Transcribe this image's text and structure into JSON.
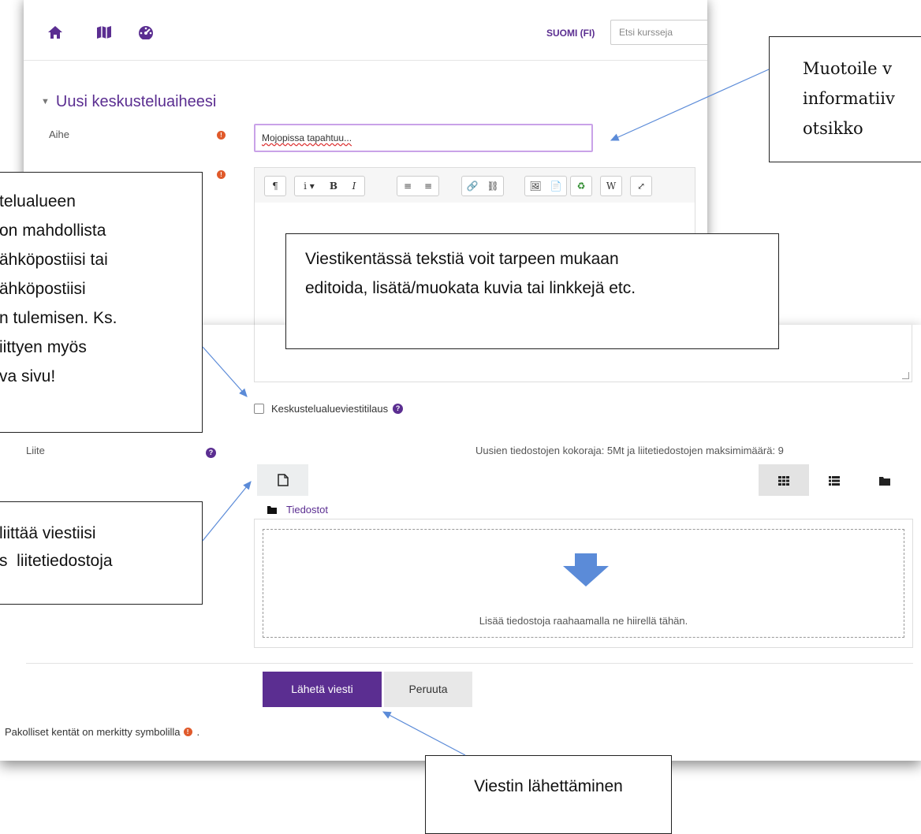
{
  "header": {
    "language": "SUOMI (FI)",
    "search_placeholder": "Etsi kursseja",
    "icons": [
      "home-icon",
      "map-icon",
      "dashboard-icon"
    ]
  },
  "form": {
    "section_title": "Uusi keskusteluaiheesi",
    "subject_label": "Aihe",
    "subject_value": "Mojopissa tapahtuu...",
    "subscribe_label": "Keskustelualueviestitilaus",
    "attachment_label": "Liite",
    "limits_text": "Uusien tiedostojen kokoraja: 5Mt ja liitetiedostojen maksimimäärä: 9",
    "folder_label": "Tiedostot",
    "drop_hint": "Lisää tiedostoja raahaamalla ne hiirellä tähän.",
    "submit_label": "Lähetä viesti",
    "cancel_label": "Peruuta",
    "required_note": "Pakolliset kentät on merkitty symbolilla",
    "required_note_end": "."
  },
  "editor_toolbar": [
    "¶",
    "i ▾",
    "B",
    "I",
    "≡",
    "≡",
    "🔗",
    "⛓",
    "🖼",
    "📄",
    "♻",
    "W",
    "⤢"
  ],
  "callouts": {
    "title_lines": [
      "Muotoile v",
      "informatiiv",
      "otsikko"
    ],
    "subscribe_lines": [
      "telualueen",
      "on mahdollista",
      "ähköpostiisi tai",
      "ähköpostiisi",
      "n tulemisen. Ks.",
      "iittyen myös",
      "va sivu!"
    ],
    "editor_lines": [
      "Viestikentässä tekstiä voit tarpeen mukaan",
      "editoida, lisätä/muokata kuvia tai linkkejä etc."
    ],
    "attachment_lines": [
      "liittää viestiisi",
      "s  liitetiedostoja"
    ],
    "send": "Viestin lähettäminen"
  }
}
